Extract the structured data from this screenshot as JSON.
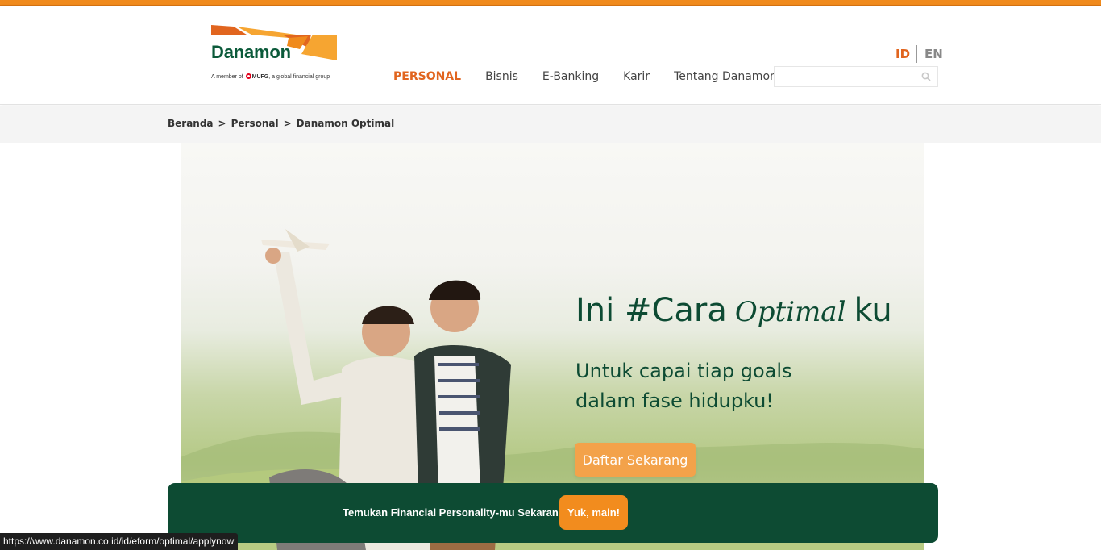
{
  "brand": {
    "name": "Danamon",
    "tagline_prefix": "A member of",
    "tagline_group": "MUFG",
    "tagline_suffix": ", a global financial group",
    "accent_orange": "#f08a1c",
    "brand_green": "#0b5a3a"
  },
  "nav": {
    "items": [
      {
        "label": "PERSONAL",
        "active": true
      },
      {
        "label": "Bisnis",
        "active": false
      },
      {
        "label": "E-Banking",
        "active": false
      },
      {
        "label": "Karir",
        "active": false
      },
      {
        "label": "Tentang Danamon",
        "active": false
      }
    ]
  },
  "lang": {
    "id": "ID",
    "en": "EN",
    "selected": "ID"
  },
  "search": {
    "value": "",
    "placeholder": "",
    "icon": "search-icon"
  },
  "breadcrumb": {
    "items": [
      "Beranda",
      "Personal",
      "Danamon Optimal"
    ],
    "separator": ">"
  },
  "hero": {
    "title_prefix": "Ini #Cara",
    "title_script": "Optimal",
    "title_suffix": "ku",
    "subtitle_line1": "Untuk capai tiap goals",
    "subtitle_line2": "dalam fase hidupku!",
    "cta_label": "Daftar Sekarang"
  },
  "promo": {
    "text": "Temukan Financial Personality-mu Sekarang!",
    "cta_label": "Yuk, main!"
  },
  "status_bar": {
    "url": "https://www.danamon.co.id/id/eform/optimal/applynow"
  }
}
